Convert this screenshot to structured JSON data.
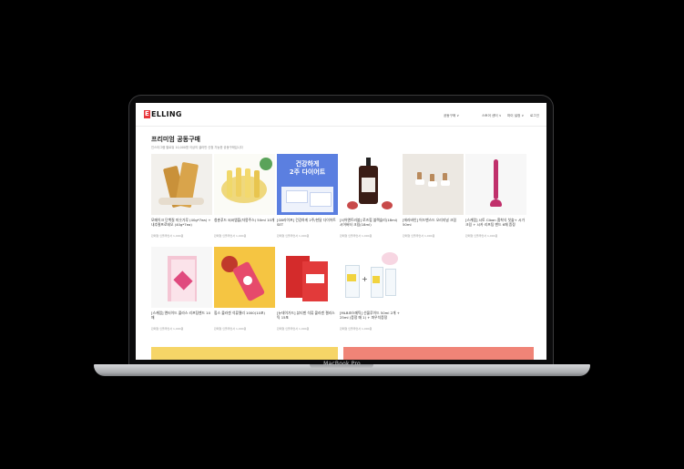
{
  "device": {
    "model_label": "MacBook Pro"
  },
  "site": {
    "logo_mark": "E",
    "logo_text": "ELLING",
    "nav": [
      "공동구매 ∨",
      "스토어 센터 ∨",
      "마이 설정 ∨",
      "로그인"
    ]
  },
  "page": {
    "title": "프리미엄 공동구매",
    "subtitle": "인스타그램 팔로워 10,000명 이상의 셀러만 신청 가능한 공동구매입니다"
  },
  "products": [
    {
      "name": "모메이크 단백질 미숫가루 (40g*7ea) + 내추럴프로테오 (40g*7ea)",
      "meta": "판매형 인플루언서 1,000원",
      "bg": "#f2f0ec"
    },
    {
      "name": "청춘푸드 씨씨앰플(자몽주스) 50ml 10개",
      "meta": "판매형 인플루언서 1,000원",
      "bg": "#fbfbf6"
    },
    {
      "name": "[GB라이프] 건강하게 2주/한달 다이어트 SET",
      "meta": "판매형 인플루언서 1,000원",
      "bg": "#5b7fe0",
      "badge_line1": "건강하게",
      "badge_line2": "2주 다이어트"
    },
    {
      "name": "[시어엔트러블] 로즈힙 블랙슬리(18ml) 시어버터 크림(18ml)",
      "meta": "판매형 인플루언서 1,000원",
      "bg": "#ffffff"
    },
    {
      "name": "[에라바인] 어드밴스드 오리지널 크림 50ml",
      "meta": "판매형 인플루언서 1,000원",
      "bg": "#ece8e2"
    },
    {
      "name": "[스캐럽] 시토 Cibon 흡착식 칫솔+ 시가 크림 + 시카 리프팅 밴드 6매 증정",
      "meta": "판매형 인플루언서 1,000원",
      "bg": "#f7f7f7"
    },
    {
      "name": "[스캐럽] 엔터이드 콜라스 리프팅밴드 10매",
      "meta": "판매형 인플루언서 1,000원",
      "bg": "#f7f7f7"
    },
    {
      "name": "힙스 콜라겐 석류젤리 1000(10포)",
      "meta": "판매형 인플루언서 1,000원",
      "bg": "#f5c542"
    },
    {
      "name": "[뉴데이가드] 뷰티젠 석류 콜라겐 젤리스틱 15포",
      "meta": "판매형 인플루언서 1,000원",
      "bg": "#ffffff"
    },
    {
      "name": "[MLB코스메틱] 선물루이드 50ml 2개 + 25ml (증정 매 1) + 파우치증정",
      "meta": "판매형 인플루언서 1,000원",
      "bg": "#ffffff"
    }
  ],
  "banners": [
    {
      "color": "#f6d567"
    },
    {
      "color": "#f08477"
    }
  ]
}
